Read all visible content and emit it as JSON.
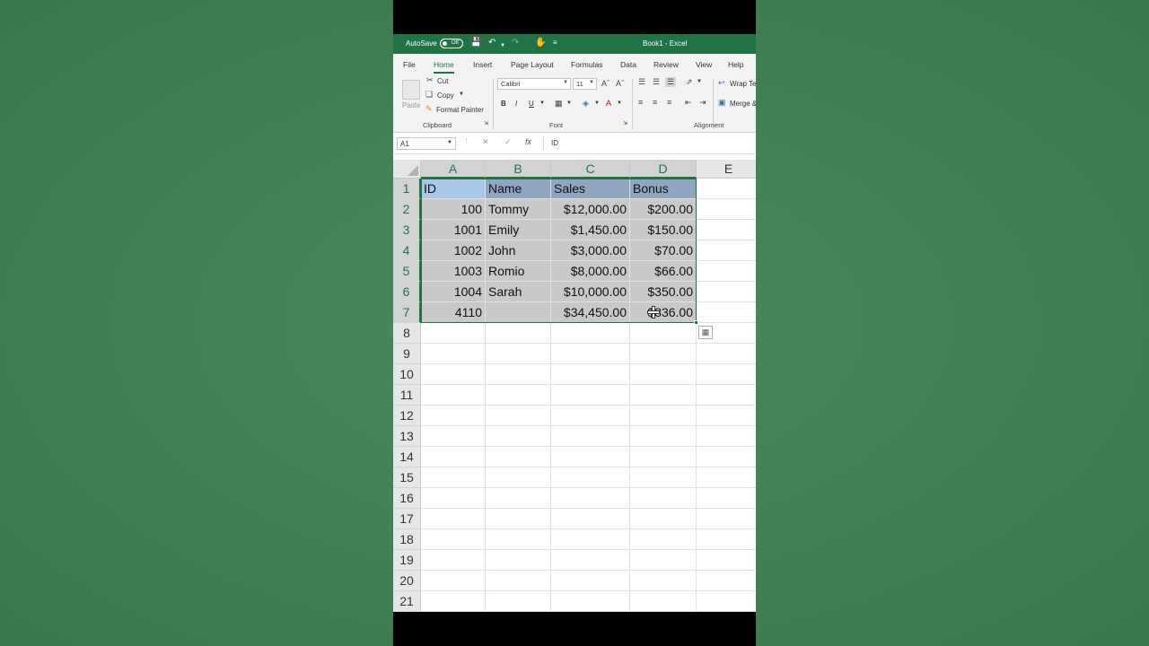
{
  "window": {
    "autosave_label": "AutoSave",
    "autosave_state": "Off",
    "doc_title": "Book1  -  Excel"
  },
  "tabs": [
    "File",
    "Home",
    "Insert",
    "Page Layout",
    "Formulas",
    "Data",
    "Review",
    "View",
    "Help"
  ],
  "ribbon": {
    "clipboard": {
      "paste": "Paste",
      "cut": "Cut",
      "copy": "Copy",
      "format_painter": "Format Painter",
      "label": "Clipboard"
    },
    "font": {
      "family": "Calibri",
      "size": "11",
      "bold": "B",
      "italic": "I",
      "underline": "U",
      "label": "Font"
    },
    "alignment": {
      "wrap_text": "Wrap Te",
      "merge": "Merge &",
      "label": "Alignment"
    }
  },
  "formula_bar": {
    "name_box": "A1",
    "fx": "fx",
    "content": "ID"
  },
  "sheet": {
    "columns": [
      "A",
      "B",
      "C",
      "D",
      "E"
    ],
    "row_numbers": [
      "1",
      "2",
      "3",
      "4",
      "5",
      "6",
      "7",
      "8",
      "9",
      "10",
      "11",
      "12",
      "13",
      "14",
      "15",
      "16",
      "17",
      "18",
      "19",
      "20",
      "21"
    ],
    "header": [
      "ID",
      "Name",
      "Sales",
      "Bonus"
    ],
    "rows": [
      [
        "100",
        "Tommy",
        "$12,000.00",
        "$200.00"
      ],
      [
        "1001",
        "Emily",
        "$1,450.00",
        "$150.00"
      ],
      [
        "1002",
        "John",
        "$3,000.00",
        "$70.00"
      ],
      [
        "1003",
        "Romio",
        "$8,000.00",
        "$66.00"
      ],
      [
        "1004",
        "Sarah",
        "$10,000.00",
        "$350.00"
      ],
      [
        "4110",
        "",
        "$34,450.00",
        "$836.00"
      ]
    ]
  },
  "colors": {
    "excel_green": "#217346",
    "header_fill": "#8ea6bf",
    "active_cell_fill": "#a9c7e6",
    "selection_fill": "#c9c9c9"
  }
}
